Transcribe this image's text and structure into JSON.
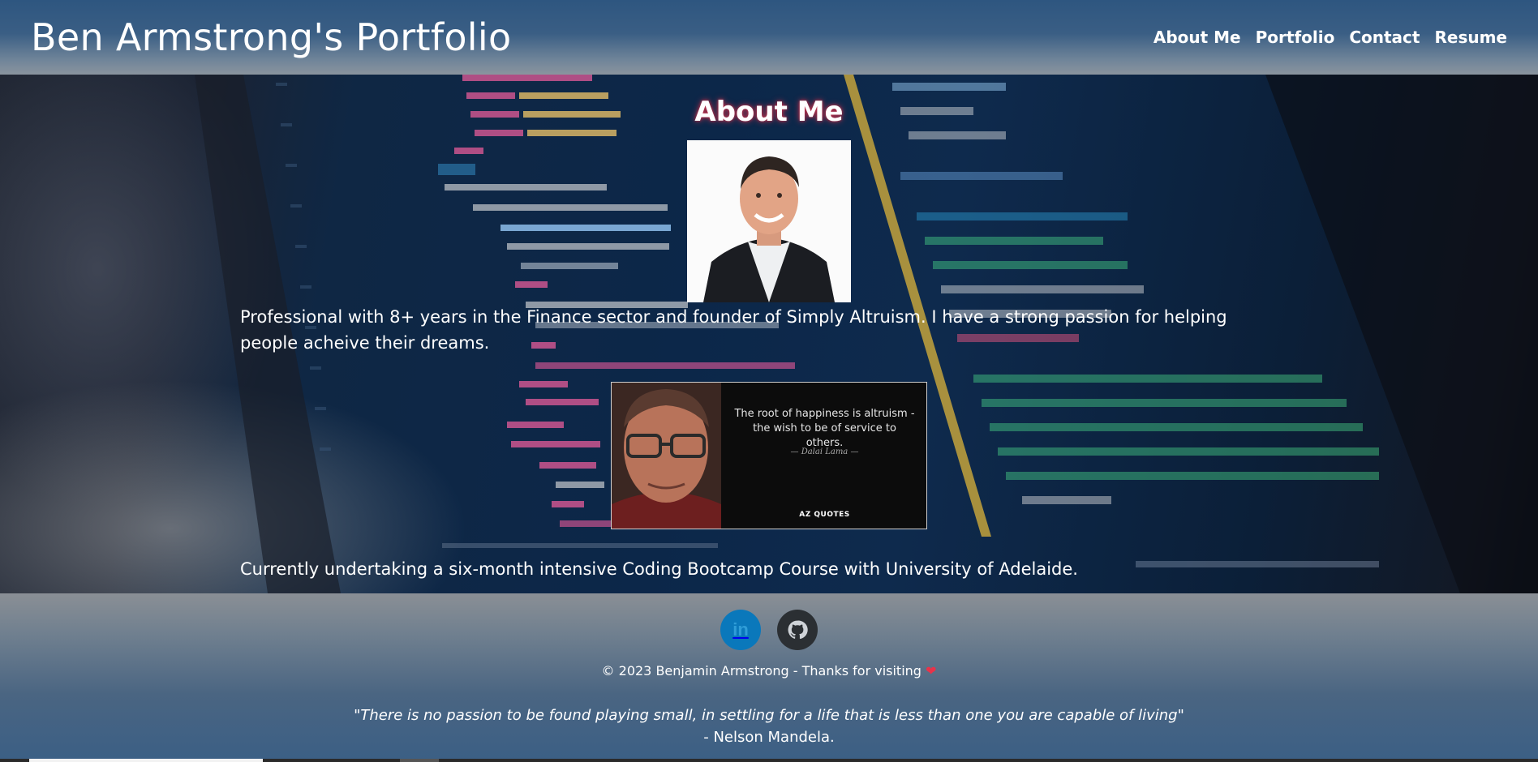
{
  "header": {
    "title": "Ben Armstrong's Portfolio",
    "nav": [
      "About Me",
      "Portfolio",
      "Contact",
      "Resume"
    ]
  },
  "about": {
    "heading": "About Me",
    "bio": "Professional with 8+ years in the Finance sector and founder of Simply Altruism. I have a strong passion for helping people acheive their dreams.",
    "quote_image": {
      "text": "The root of happiness is altruism - the wish to be of service to others.",
      "author": "Dalai Lama",
      "brand": "AZ QUOTES"
    },
    "bootcamp": "Currently undertaking a six-month intensive Coding Bootcamp Course with University of Adelaide."
  },
  "footer": {
    "social": [
      {
        "name": "linkedin-icon",
        "label": "in",
        "color": "#0a78bb"
      },
      {
        "name": "github-icon",
        "color": "#2b2f33"
      }
    ],
    "copyright": "© 2023 Benjamin Armstrong - Thanks for visiting",
    "heart": "❤",
    "quote": "\"There is no passion to be found playing small, in settling for a life that is less than one you are capable of living\"",
    "quote_author": "- Nelson Mandela."
  },
  "colors": {
    "header_top": "#2e5680",
    "heading_glow": "#c0304a",
    "linkedin": "#0a78bb"
  }
}
